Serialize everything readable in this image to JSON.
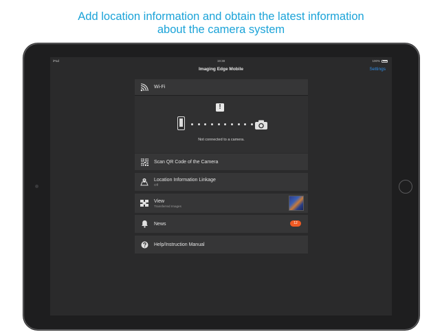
{
  "headline": {
    "line1": "Add location information and obtain the latest information",
    "line2": "about the camera system"
  },
  "status_bar": {
    "device": "iPad",
    "time": "19:38",
    "battery": "100%"
  },
  "nav": {
    "title": "Imaging Edge Mobile",
    "settings": "Settings"
  },
  "wifi": {
    "label": "Wi-Fi",
    "status": "Not connected to a camera."
  },
  "menu": {
    "qr": {
      "label": "Scan QR Code of the Camera"
    },
    "location": {
      "label": "Location Information Linkage",
      "sub": "Off"
    },
    "view": {
      "label": "View",
      "sub": "Transferred Images"
    },
    "news": {
      "label": "News",
      "badge": "12"
    },
    "help": {
      "label": "Help/Instruction Manual"
    }
  },
  "colors": {
    "headline": "#1ba3d8",
    "accent": "#2f8ee8",
    "badge": "#f05a24"
  }
}
